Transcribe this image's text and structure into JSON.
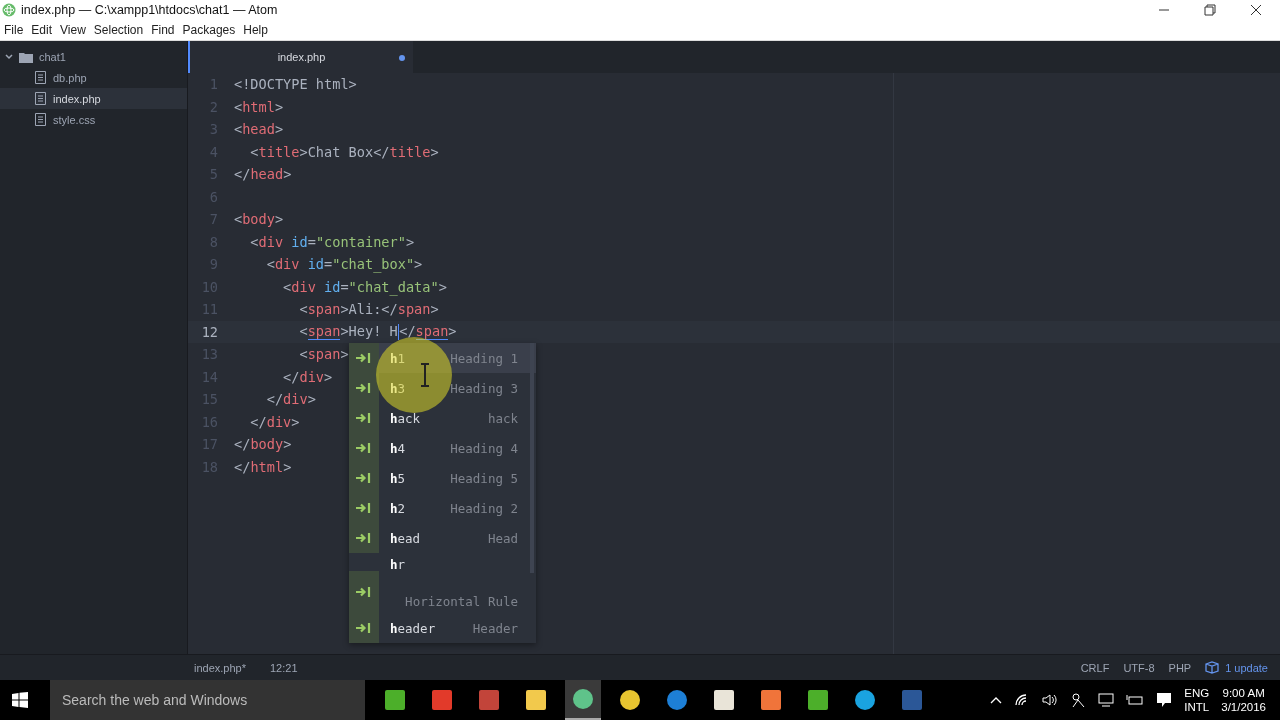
{
  "window": {
    "title": "index.php — C:\\xampp1\\htdocs\\chat1 — Atom"
  },
  "menu": [
    "File",
    "Edit",
    "View",
    "Selection",
    "Find",
    "Packages",
    "Help"
  ],
  "tree": {
    "folder": {
      "name": "chat1",
      "expanded": true
    },
    "files": [
      {
        "name": "db.php",
        "selected": false
      },
      {
        "name": "index.php",
        "selected": true
      },
      {
        "name": "style.css",
        "selected": false
      }
    ]
  },
  "tabs": [
    {
      "label": "index.php",
      "modified": true,
      "selected": true
    }
  ],
  "lines": [
    {
      "number": "1",
      "current": false,
      "code": [
        {
          "kind": "punct",
          "t": "<!DOCTYPE html>"
        }
      ]
    },
    {
      "number": "2",
      "current": false,
      "code": [
        {
          "kind": "punct",
          "t": "<"
        },
        {
          "kind": "tag",
          "t": "html"
        },
        {
          "kind": "punct",
          "t": ">"
        }
      ]
    },
    {
      "number": "3",
      "current": false,
      "code": [
        {
          "kind": "punct",
          "t": "<"
        },
        {
          "kind": "tag",
          "t": "head"
        },
        {
          "kind": "punct",
          "t": ">"
        }
      ]
    },
    {
      "number": "4",
      "current": false,
      "code": [
        {
          "kind": "punct",
          "t": "  <"
        },
        {
          "kind": "tag",
          "t": "title"
        },
        {
          "kind": "punct",
          "t": ">"
        },
        {
          "kind": "text",
          "t": "Chat Box"
        },
        {
          "kind": "punct",
          "t": "</"
        },
        {
          "kind": "tag",
          "t": "title"
        },
        {
          "kind": "punct",
          "t": ">"
        }
      ]
    },
    {
      "number": "5",
      "current": false,
      "code": [
        {
          "kind": "punct",
          "t": "</"
        },
        {
          "kind": "tag",
          "t": "head"
        },
        {
          "kind": "punct",
          "t": ">"
        }
      ]
    },
    {
      "number": "6",
      "current": false
    },
    {
      "number": "7",
      "current": false,
      "code": [
        {
          "kind": "punct",
          "t": "<"
        },
        {
          "kind": "tag",
          "t": "body"
        },
        {
          "kind": "punct",
          "t": ">"
        }
      ]
    },
    {
      "number": "8",
      "current": false,
      "code": [
        {
          "kind": "punct",
          "t": "  <"
        },
        {
          "kind": "tag",
          "t": "div"
        },
        {
          "kind": "attr",
          "t": " id"
        },
        {
          "kind": "punct",
          "t": "="
        },
        {
          "kind": "str",
          "t": "\"container\""
        },
        {
          "kind": "punct",
          "t": ">"
        }
      ]
    },
    {
      "number": "9",
      "current": false,
      "code": [
        {
          "kind": "punct",
          "t": "    <"
        },
        {
          "kind": "tag",
          "t": "div"
        },
        {
          "kind": "attr",
          "t": " id"
        },
        {
          "kind": "punct",
          "t": "="
        },
        {
          "kind": "str",
          "t": "\"chat_box\""
        },
        {
          "kind": "punct",
          "t": ">"
        }
      ]
    },
    {
      "number": "10",
      "current": false,
      "code": [
        {
          "kind": "punct",
          "t": "      <"
        },
        {
          "kind": "tag",
          "t": "div"
        },
        {
          "kind": "attr",
          "t": " id"
        },
        {
          "kind": "punct",
          "t": "="
        },
        {
          "kind": "str",
          "t": "\"chat_data\""
        },
        {
          "kind": "punct",
          "t": ">"
        }
      ]
    },
    {
      "number": "11",
      "current": false,
      "code": [
        {
          "kind": "punct",
          "t": "        <"
        },
        {
          "kind": "tag",
          "t": "span"
        },
        {
          "kind": "punct",
          "t": ">"
        },
        {
          "kind": "text",
          "t": "Ali:"
        },
        {
          "kind": "punct",
          "t": "</"
        },
        {
          "kind": "tag",
          "t": "span"
        },
        {
          "kind": "punct",
          "t": ">"
        }
      ]
    },
    {
      "number": "12",
      "current": true,
      "code": [
        {
          "kind": "punct",
          "t": "        <"
        },
        {
          "kind": "match",
          "t": "span"
        },
        {
          "kind": "punct",
          "t": ">"
        },
        {
          "kind": "text",
          "t": "Hey! H"
        },
        {
          "kind": "cursor"
        },
        {
          "kind": "punct",
          "t": "</"
        },
        {
          "kind": "match",
          "t": "span"
        },
        {
          "kind": "punct",
          "t": ">"
        }
      ]
    },
    {
      "number": "13",
      "current": false,
      "code": [
        {
          "kind": "punct",
          "t": "        <"
        },
        {
          "kind": "tag",
          "t": "span"
        },
        {
          "kind": "punct",
          "t": ">"
        }
      ]
    },
    {
      "number": "14",
      "current": false,
      "code": [
        {
          "kind": "punct",
          "t": "      </"
        },
        {
          "kind": "tag",
          "t": "div"
        },
        {
          "kind": "punct",
          "t": ">"
        }
      ]
    },
    {
      "number": "15",
      "current": false,
      "code": [
        {
          "kind": "punct",
          "t": "    </"
        },
        {
          "kind": "tag",
          "t": "div"
        },
        {
          "kind": "punct",
          "t": ">"
        }
      ]
    },
    {
      "number": "16",
      "current": false,
      "code": [
        {
          "kind": "punct",
          "t": "  </"
        },
        {
          "kind": "tag",
          "t": "div"
        },
        {
          "kind": "punct",
          "t": ">"
        }
      ]
    },
    {
      "number": "17",
      "current": false,
      "code": [
        {
          "kind": "punct",
          "t": "</"
        },
        {
          "kind": "tag",
          "t": "body"
        },
        {
          "kind": "punct",
          "t": ">"
        }
      ]
    },
    {
      "number": "18",
      "current": false,
      "code": [
        {
          "kind": "punct",
          "t": "</"
        },
        {
          "kind": "tag",
          "t": "html"
        },
        {
          "kind": "punct",
          "t": ">"
        }
      ]
    }
  ],
  "autocomplete": [
    {
      "kind": "inline",
      "match": "h",
      "rest": "1",
      "description": "Heading 1",
      "selected": true
    },
    {
      "kind": "inline",
      "match": "h",
      "rest": "3",
      "description": "Heading 3",
      "selected": false
    },
    {
      "kind": "inline",
      "match": "h",
      "rest": "ack",
      "description": "hack",
      "selected": false
    },
    {
      "kind": "inline",
      "match": "h",
      "rest": "4",
      "description": "Heading 4",
      "selected": false
    },
    {
      "kind": "inline",
      "match": "h",
      "rest": "5",
      "description": "Heading 5",
      "selected": false
    },
    {
      "kind": "inline",
      "match": "h",
      "rest": "2",
      "description": "Heading 2",
      "selected": false
    },
    {
      "kind": "inline",
      "match": "h",
      "rest": "ead",
      "description": "Head",
      "selected": false
    },
    {
      "kind": "wrapped",
      "match": "h",
      "rest": "r",
      "description": "Horizontal Rule",
      "selected": false
    },
    {
      "kind": "inline",
      "match": "h",
      "rest": "eader",
      "description": "Header",
      "selected": false
    }
  ],
  "status_bar": {
    "file": "index.php*",
    "position": "12:21",
    "line_ending": "CRLF",
    "encoding": "UTF-8",
    "grammar": "PHP",
    "update": "1 update"
  },
  "taskbar": {
    "search": {
      "placeholder": "Search the web and Windows"
    },
    "apps": [
      {
        "kind": "camtasia",
        "active": false
      },
      {
        "kind": "character",
        "active": false
      },
      {
        "kind": "cocktail",
        "active": false
      },
      {
        "kind": "folder",
        "active": false
      },
      {
        "kind": "atom",
        "active": true
      },
      {
        "kind": "chrome",
        "active": false
      },
      {
        "kind": "edge",
        "active": false
      },
      {
        "kind": "notepad",
        "active": false
      },
      {
        "kind": "xampp",
        "active": false
      },
      {
        "kind": "camtasia",
        "active": false
      },
      {
        "kind": "skype",
        "active": false
      },
      {
        "kind": "word",
        "active": false
      }
    ],
    "language": [
      "ENG",
      "INTL"
    ],
    "time": "9:00 AM",
    "date": "3/1/2016"
  }
}
